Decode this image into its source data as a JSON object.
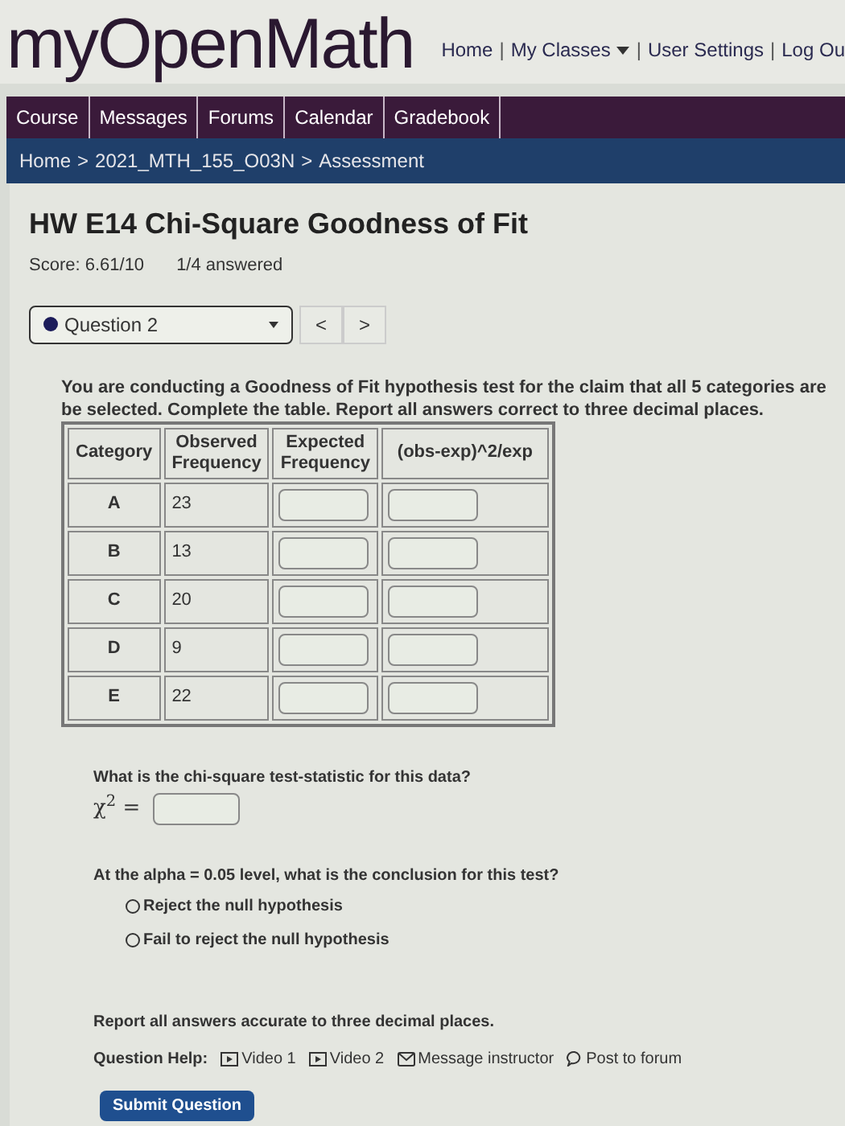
{
  "logo": "myOpenMath",
  "top_links": [
    {
      "kind": "link",
      "label": "Home"
    },
    {
      "kind": "separator",
      "label": "|"
    },
    {
      "kind": "menu",
      "label": "My Classes"
    },
    {
      "kind": "separator",
      "label": "|"
    },
    {
      "kind": "link",
      "label": "User Settings"
    },
    {
      "kind": "separator",
      "label": "|"
    },
    {
      "kind": "link",
      "label": "Log Ou"
    }
  ],
  "nav_tabs": [
    {
      "label": "Course"
    },
    {
      "label": "Messages"
    },
    {
      "label": "Forums"
    },
    {
      "label": "Calendar"
    },
    {
      "label": "Gradebook"
    }
  ],
  "breadcrumb": [
    "Home",
    ">",
    "2021_MTH_155_O03N",
    ">",
    "Assessment"
  ],
  "title": "HW E14 Chi-Square Goodness of Fit",
  "score": "Score: 6.61/10",
  "answered": "1/4 answered",
  "question_select": {
    "value": "Question 2"
  },
  "pager": [
    "<",
    ">"
  ],
  "intro_lines": [
    "You are conducting a Goodness of Fit hypothesis test for the claim that all 5 categories are",
    "be selected. Complete the table. Report all answers correct to three decimal places."
  ],
  "table": {
    "columns": [
      "Category",
      "Observed Frequency",
      "Expected Frequency",
      "(obs-exp)^2/exp"
    ],
    "rows": [
      {
        "category": "A",
        "observed": "23"
      },
      {
        "category": "B",
        "observed": "13"
      },
      {
        "category": "C",
        "observed": "20"
      },
      {
        "category": "D",
        "observed": "9"
      },
      {
        "category": "E",
        "observed": "22"
      }
    ]
  },
  "stat_question": "What is the chi-square test-statistic for this data?",
  "stat_label": "χ$^{2}$ =",
  "conclusion_question": "At the alpha = 0.05 level, what is the conclusion for this test?",
  "options": [
    {
      "label": "Reject the null hypothesis",
      "selected": false
    },
    {
      "label": "Fail to reject the null hypothesis",
      "selected": false
    }
  ],
  "report_note": "Report all answers accurate to three decimal places.",
  "help_label": "Question Help:",
  "help_links": [
    {
      "kind": "video",
      "label": "Video 1"
    },
    {
      "kind": "video",
      "label": "Video 2"
    },
    {
      "kind": "message",
      "label": "Message instructor"
    },
    {
      "kind": "forum",
      "label": "Post to forum"
    }
  ],
  "submit": "Submit Question"
}
